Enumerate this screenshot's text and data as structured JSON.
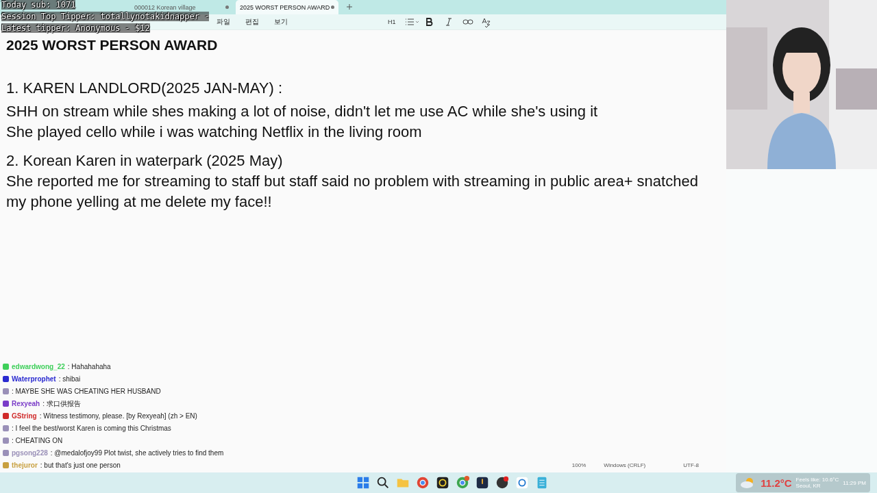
{
  "stream_overlay": {
    "lines": [
      "Today sub: 1071",
      "Session Top Tipper: totallynotakidnapper -",
      "Latest tipper: Anonymous - $12"
    ]
  },
  "tabs": [
    {
      "label": "000012 Korean village",
      "selected": false
    },
    {
      "label": "2025 WORST PERSON AWARD",
      "selected": true
    }
  ],
  "menu": [
    "파일",
    "편집",
    "보기"
  ],
  "toolbar": {
    "heading": "H1"
  },
  "document": {
    "title": "2025 WORST PERSON AWARD",
    "paragraphs": [
      {
        "kind": "heading",
        "text": "1.  KAREN LANDLORD(2025 JAN-MAY) :"
      },
      {
        "kind": "body",
        "text": "SHH on stream while shes making a lot of noise, didn't let me use AC while she's using it"
      },
      {
        "kind": "body",
        "text": "She played cello while i was watching Netflix in the living room"
      },
      {
        "kind": "gap"
      },
      {
        "kind": "body",
        "text": "2. Korean Karen in waterpark (2025 May)"
      },
      {
        "kind": "body",
        "text": "She reported me for streaming to staff but staff said no problem with streaming in public area+ snatched my phone yelling at me delete my face!!"
      }
    ]
  },
  "status_bar": {
    "zoom": "100%",
    "line_ending": "Windows (CRLF)",
    "encoding": "UTF-8"
  },
  "chat": [
    {
      "user": "edwardwong_22",
      "color": "#3ecf5a",
      "message": ": Hahahahaha"
    },
    {
      "user": "Waterprophet",
      "color": "#2a2ad0",
      "message": ": shibai"
    },
    {
      "color": "#9a90b8",
      "message": ": MAYBE SHE WAS CHEATING HER HUSBAND"
    },
    {
      "user": "Rexyeah",
      "color": "#7a3cc8",
      "message": ": 求口供报告"
    },
    {
      "user": "GString",
      "color": "#d02a2a",
      "message": ": Witness testimony, please. [by Rexyeah] (zh > EN)"
    },
    {
      "color": "#9a90b8",
      "message": ": I feel the best/worst Karen is coming this Christmas"
    },
    {
      "color": "#9a90b8",
      "message": ": CHEATING ON"
    },
    {
      "user": "pgsong228",
      "color": "#9a90b8",
      "message": ": @medalofjoy99 Plot twist, she actively tries to find them"
    },
    {
      "user": "thejuror",
      "color": "#c8a040",
      "message": ": but that's just one person"
    }
  ],
  "weather": {
    "temperature": "11.2°C",
    "feels_like": "Feels like: 10.6°C",
    "location": "Seoul, KR",
    "time": "11:29 PM"
  }
}
